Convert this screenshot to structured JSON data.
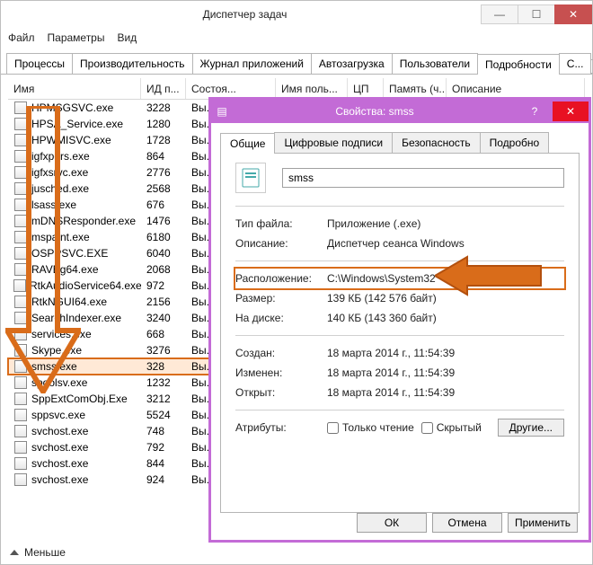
{
  "tm": {
    "title": "Диспетчер задач",
    "menu": [
      "Файл",
      "Параметры",
      "Вид"
    ],
    "tabs": [
      "Процессы",
      "Производительность",
      "Журнал приложений",
      "Автозагрузка",
      "Пользователи",
      "Подробности",
      "С..."
    ],
    "tabs_selected": 5,
    "columns": {
      "name": "Имя",
      "pid": "ИД п...",
      "status": "Состоя...",
      "user": "Имя поль...",
      "cpu": "ЦП",
      "mem": "Память (ч...",
      "desc": "Описание"
    },
    "rows": [
      {
        "name": "HPMSGSVC.exe",
        "pid": "3228",
        "status": "Вы..."
      },
      {
        "name": "HPSA_Service.exe",
        "pid": "1280",
        "status": "Вы..."
      },
      {
        "name": "HPWMISVC.exe",
        "pid": "1728",
        "status": "Вы..."
      },
      {
        "name": "igfxpers.exe",
        "pid": "864",
        "status": "Вы..."
      },
      {
        "name": "igfxsrvc.exe",
        "pid": "2776",
        "status": "Вы..."
      },
      {
        "name": "jusched.exe",
        "pid": "2568",
        "status": "Вы..."
      },
      {
        "name": "lsass.exe",
        "pid": "676",
        "status": "Вы..."
      },
      {
        "name": "mDNSResponder.exe",
        "pid": "1476",
        "status": "Вы..."
      },
      {
        "name": "mspaint.exe",
        "pid": "6180",
        "status": "Вы..."
      },
      {
        "name": "OSPPSVC.EXE",
        "pid": "6040",
        "status": "Вы..."
      },
      {
        "name": "RAVBg64.exe",
        "pid": "2068",
        "status": "Вы..."
      },
      {
        "name": "RtkAudioService64.exe",
        "pid": "972",
        "status": "Вы..."
      },
      {
        "name": "RtkNGUI64.exe",
        "pid": "2156",
        "status": "Вы..."
      },
      {
        "name": "SearchIndexer.exe",
        "pid": "3240",
        "status": "Вы..."
      },
      {
        "name": "services.exe",
        "pid": "668",
        "status": "Вы..."
      },
      {
        "name": "Skype.exe",
        "pid": "3276",
        "status": "Вы..."
      },
      {
        "name": "smss.exe",
        "pid": "328",
        "status": "Вы...",
        "highlight": true
      },
      {
        "name": "spoolsv.exe",
        "pid": "1232",
        "status": "Вы..."
      },
      {
        "name": "SppExtComObj.Exe",
        "pid": "3212",
        "status": "Вы..."
      },
      {
        "name": "sppsvc.exe",
        "pid": "5524",
        "status": "Вы..."
      },
      {
        "name": "svchost.exe",
        "pid": "748",
        "status": "Вы..."
      },
      {
        "name": "svchost.exe",
        "pid": "792",
        "status": "Вы..."
      },
      {
        "name": "svchost.exe",
        "pid": "844",
        "status": "Вы..."
      },
      {
        "name": "svchost.exe",
        "pid": "924",
        "status": "Вы..."
      }
    ],
    "footer_label": "Меньше"
  },
  "props": {
    "title": "Свойства: smss",
    "tabs": [
      "Общие",
      "Цифровые подписи",
      "Безопасность",
      "Подробно"
    ],
    "tabs_selected": 0,
    "filename": "smss",
    "fields": {
      "filetype_label": "Тип файла:",
      "filetype_value": "Приложение (.exe)",
      "desc_label": "Описание:",
      "desc_value": "Диспетчер сеанса Windows",
      "location_label": "Расположение:",
      "location_value": "C:\\Windows\\System32",
      "size_label": "Размер:",
      "size_value": "139 КБ (142 576 байт)",
      "ondisk_label": "На диске:",
      "ondisk_value": "140 КБ (143 360 байт)",
      "created_label": "Создан:",
      "created_value": "18 марта 2014 г., 11:54:39",
      "modified_label": "Изменен:",
      "modified_value": "18 марта 2014 г., 11:54:39",
      "opened_label": "Открыт:",
      "opened_value": "18 марта 2014 г., 11:54:39",
      "attrs_label": "Атрибуты:",
      "readonly_label": "Только чтение",
      "hidden_label": "Скрытый",
      "other_button": "Другие..."
    },
    "buttons": {
      "ok": "ОК",
      "cancel": "Отмена",
      "apply": "Применить"
    }
  }
}
